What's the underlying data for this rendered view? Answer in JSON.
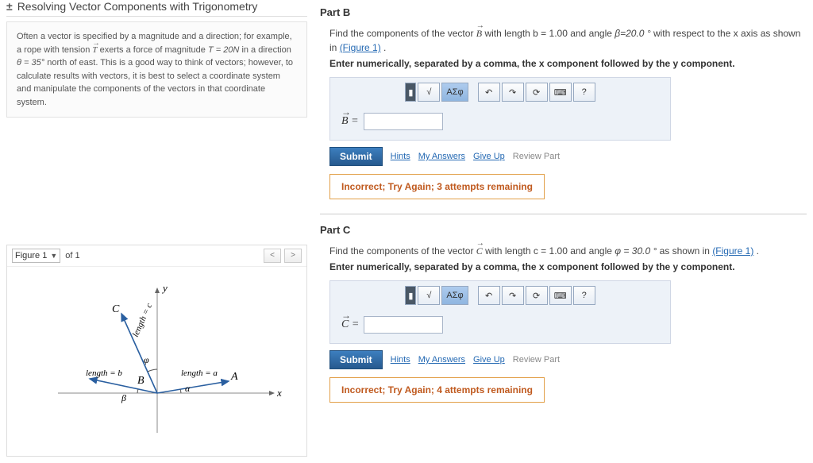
{
  "module": {
    "title": "Resolving Vector Components with Trigonometry",
    "icon": "±"
  },
  "intro": {
    "text_before": "Often a vector is specified by a magnitude and a direction; for example, a rope with tension ",
    "vec1": "T",
    "text_mid1": " exerts a force of magnitude ",
    "eq1": "T = 20N",
    "text_mid2": " in a direction ",
    "eq2": "θ = 35°",
    "text_after": " north of east. This is a good way to think of vectors; however, to calculate results with vectors, it is best to select a coordinate system and manipulate the components of the vectors in that coordinate system."
  },
  "figure": {
    "selected": "Figure 1",
    "of": "of 1"
  },
  "toolbar": {
    "templates": "√",
    "root": "√",
    "greek": "ΑΣφ",
    "undo": "↶",
    "redo": "↷",
    "reset": "⟳",
    "keyboard": "⌨",
    "help": "?"
  },
  "actions": {
    "submit": "Submit",
    "hints": "Hints",
    "myanswers": "My Answers",
    "giveup": "Give Up",
    "review": "Review Part"
  },
  "partB": {
    "header": "Part B",
    "prompt_before": "Find the components of the vector ",
    "vec": "B",
    "prompt_mid1": " with length b = 1.00 and angle ",
    "angle": "β=20.0 °",
    "prompt_after": " with respect to the x axis as shown in ",
    "fig_link": "(Figure 1)",
    "period": " .",
    "instruction": "Enter numerically, separated by a comma, the x component followed by the y component.",
    "eq_label_vec": "B",
    "eq_eq": " = ",
    "feedback": "Incorrect; Try Again; 3 attempts remaining"
  },
  "partC": {
    "header": "Part C",
    "prompt_before": "Find the components of the vector ",
    "vec": "C",
    "prompt_mid1": " with length c = 1.00 and angle ",
    "angle": "φ = 30.0 °",
    "prompt_after": " as shown in ",
    "fig_link": "(Figure 1)",
    "period": " .",
    "instruction": "Enter numerically, separated by a comma, the x component followed by the y component.",
    "eq_label_vec": "C",
    "eq_eq": " = ",
    "feedback": "Incorrect; Try Again; 4 attempts remaining"
  },
  "diagram": {
    "y": "y",
    "x": "x",
    "C": "C",
    "B": "B",
    "A": "A",
    "phi": "φ",
    "alpha": "α",
    "beta": "β",
    "len_c": "length = c",
    "len_b": "length = b",
    "len_a": "length = a"
  }
}
